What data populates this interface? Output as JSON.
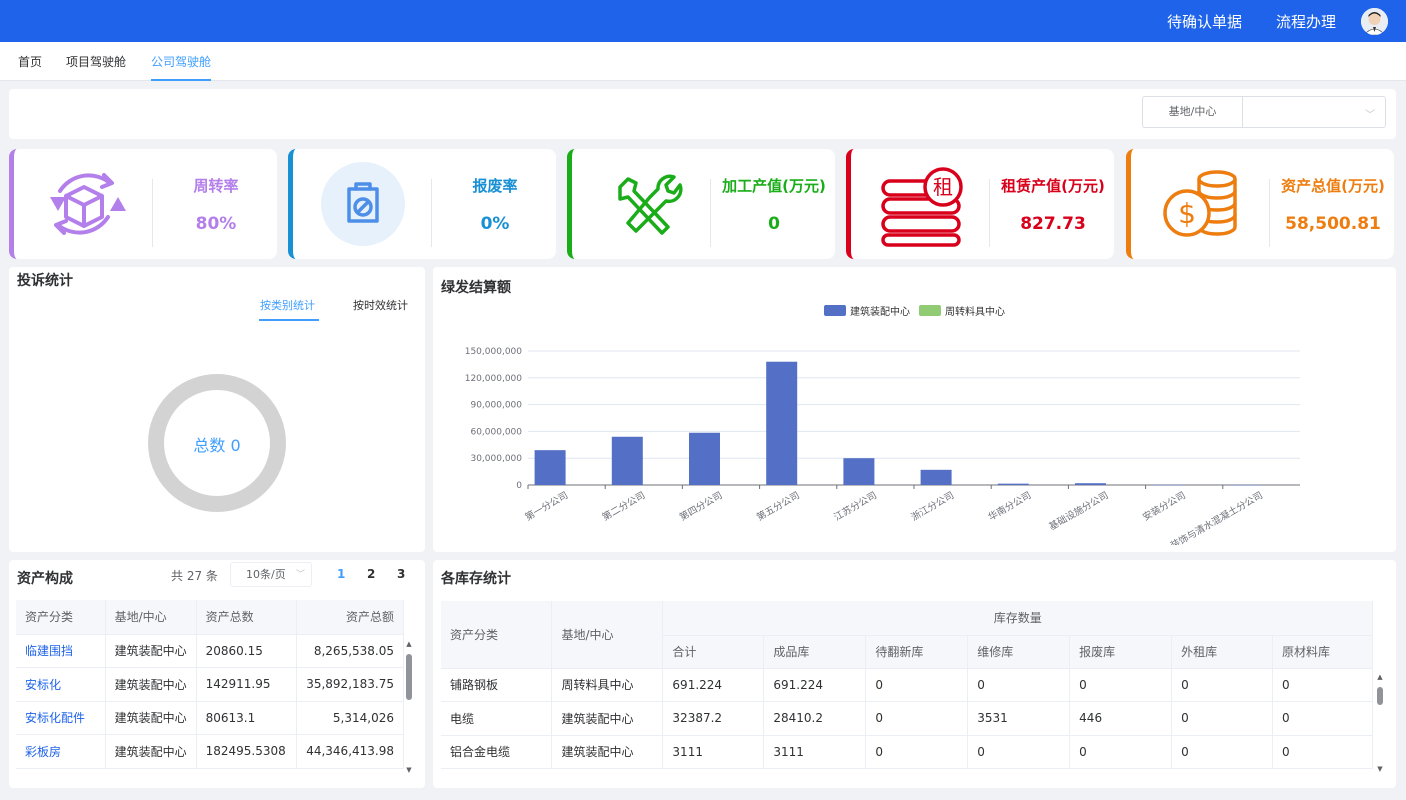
{
  "header": {
    "links": [
      "待确认单据",
      "流程办理"
    ]
  },
  "tabs": [
    {
      "label": "首页"
    },
    {
      "label": "项目驾驶舱"
    },
    {
      "label": "公司驾驶舱"
    }
  ],
  "filter": {
    "label": "基地/中心",
    "value": ""
  },
  "kpis": [
    {
      "title": "周转率",
      "value": "80%",
      "color": "#b37feb",
      "icon": "box-rotate-icon"
    },
    {
      "title": "报废率",
      "value": "0%",
      "color": "#1890d5",
      "icon": "scrap-clipboard-icon"
    },
    {
      "title": "加工产值(万元)",
      "value": "0",
      "color": "#1aad19",
      "icon": "tools-icon"
    },
    {
      "title": "租赁产值(万元)",
      "value": "827.73",
      "color": "#d9001b",
      "icon": "rent-stack-icon"
    },
    {
      "title": "资产总值(万元)",
      "value": "58,500.81",
      "color": "#ee7d10",
      "icon": "coins-icon"
    }
  ],
  "complaint": {
    "title": "投诉统计",
    "tabs": [
      "按类别统计",
      "按时效统计"
    ],
    "donut_label": "总数 0"
  },
  "settlement": {
    "title": "绿发结算额"
  },
  "chart_data": {
    "type": "bar",
    "title": "",
    "xlabel": "",
    "ylabel": "",
    "categories": [
      "第一分公司",
      "第二分公司",
      "第四分公司",
      "第五分公司",
      "江苏分公司",
      "浙江分公司",
      "华南分公司",
      "基础设施分公司",
      "安装分公司",
      "装饰与清水混凝土分公司"
    ],
    "series": [
      {
        "name": "建筑装配中心",
        "color": "#5470c6",
        "values": [
          39000000,
          54000000,
          58500000,
          138000000,
          30000000,
          17000000,
          1500000,
          2000000,
          200000,
          100000
        ]
      },
      {
        "name": "周转料具中心",
        "color": "#91cc75",
        "values": [
          0,
          0,
          0,
          0,
          0,
          0,
          0,
          0,
          0,
          0
        ]
      }
    ],
    "yticks": [
      "150,000,000",
      "120,000,000",
      "90,000,000",
      "60,000,000",
      "30,000,000",
      "0"
    ],
    "ylim": [
      0,
      150000000
    ],
    "grid": true,
    "legend": "top-center"
  },
  "assets": {
    "title": "资产构成",
    "total_text": "共 27 条",
    "page_size": "10条/页",
    "pages": [
      "1",
      "2",
      "3"
    ],
    "columns": [
      "资产分类",
      "基地/中心",
      "资产总数",
      "资产总额"
    ],
    "rows": [
      [
        "临建围挡",
        "建筑装配中心",
        "20860.15",
        "8,265,538.05"
      ],
      [
        "安标化",
        "建筑装配中心",
        "142911.95",
        "35,892,183.75"
      ],
      [
        "安标化配件",
        "建筑装配中心",
        "80613.1",
        "5,314,026"
      ],
      [
        "彩板房",
        "建筑装配中心",
        "182495.5308",
        "44,346,413.98"
      ]
    ]
  },
  "stock": {
    "title": "各库存统计",
    "group_header": "库存数量",
    "columns_left": [
      "资产分类",
      "基地/中心"
    ],
    "columns_sub": [
      "合计",
      "成品库",
      "待翻新库",
      "维修库",
      "报废库",
      "外租库",
      "原材料库"
    ],
    "rows": [
      [
        "铺路钢板",
        "周转料具中心",
        "691.224",
        "691.224",
        "0",
        "0",
        "0",
        "0",
        "0"
      ],
      [
        "电缆",
        "建筑装配中心",
        "32387.2",
        "28410.2",
        "0",
        "3531",
        "446",
        "0",
        "0"
      ],
      [
        "铝合金电缆",
        "建筑装配中心",
        "3111",
        "3111",
        "0",
        "0",
        "0",
        "0",
        "0"
      ]
    ]
  }
}
